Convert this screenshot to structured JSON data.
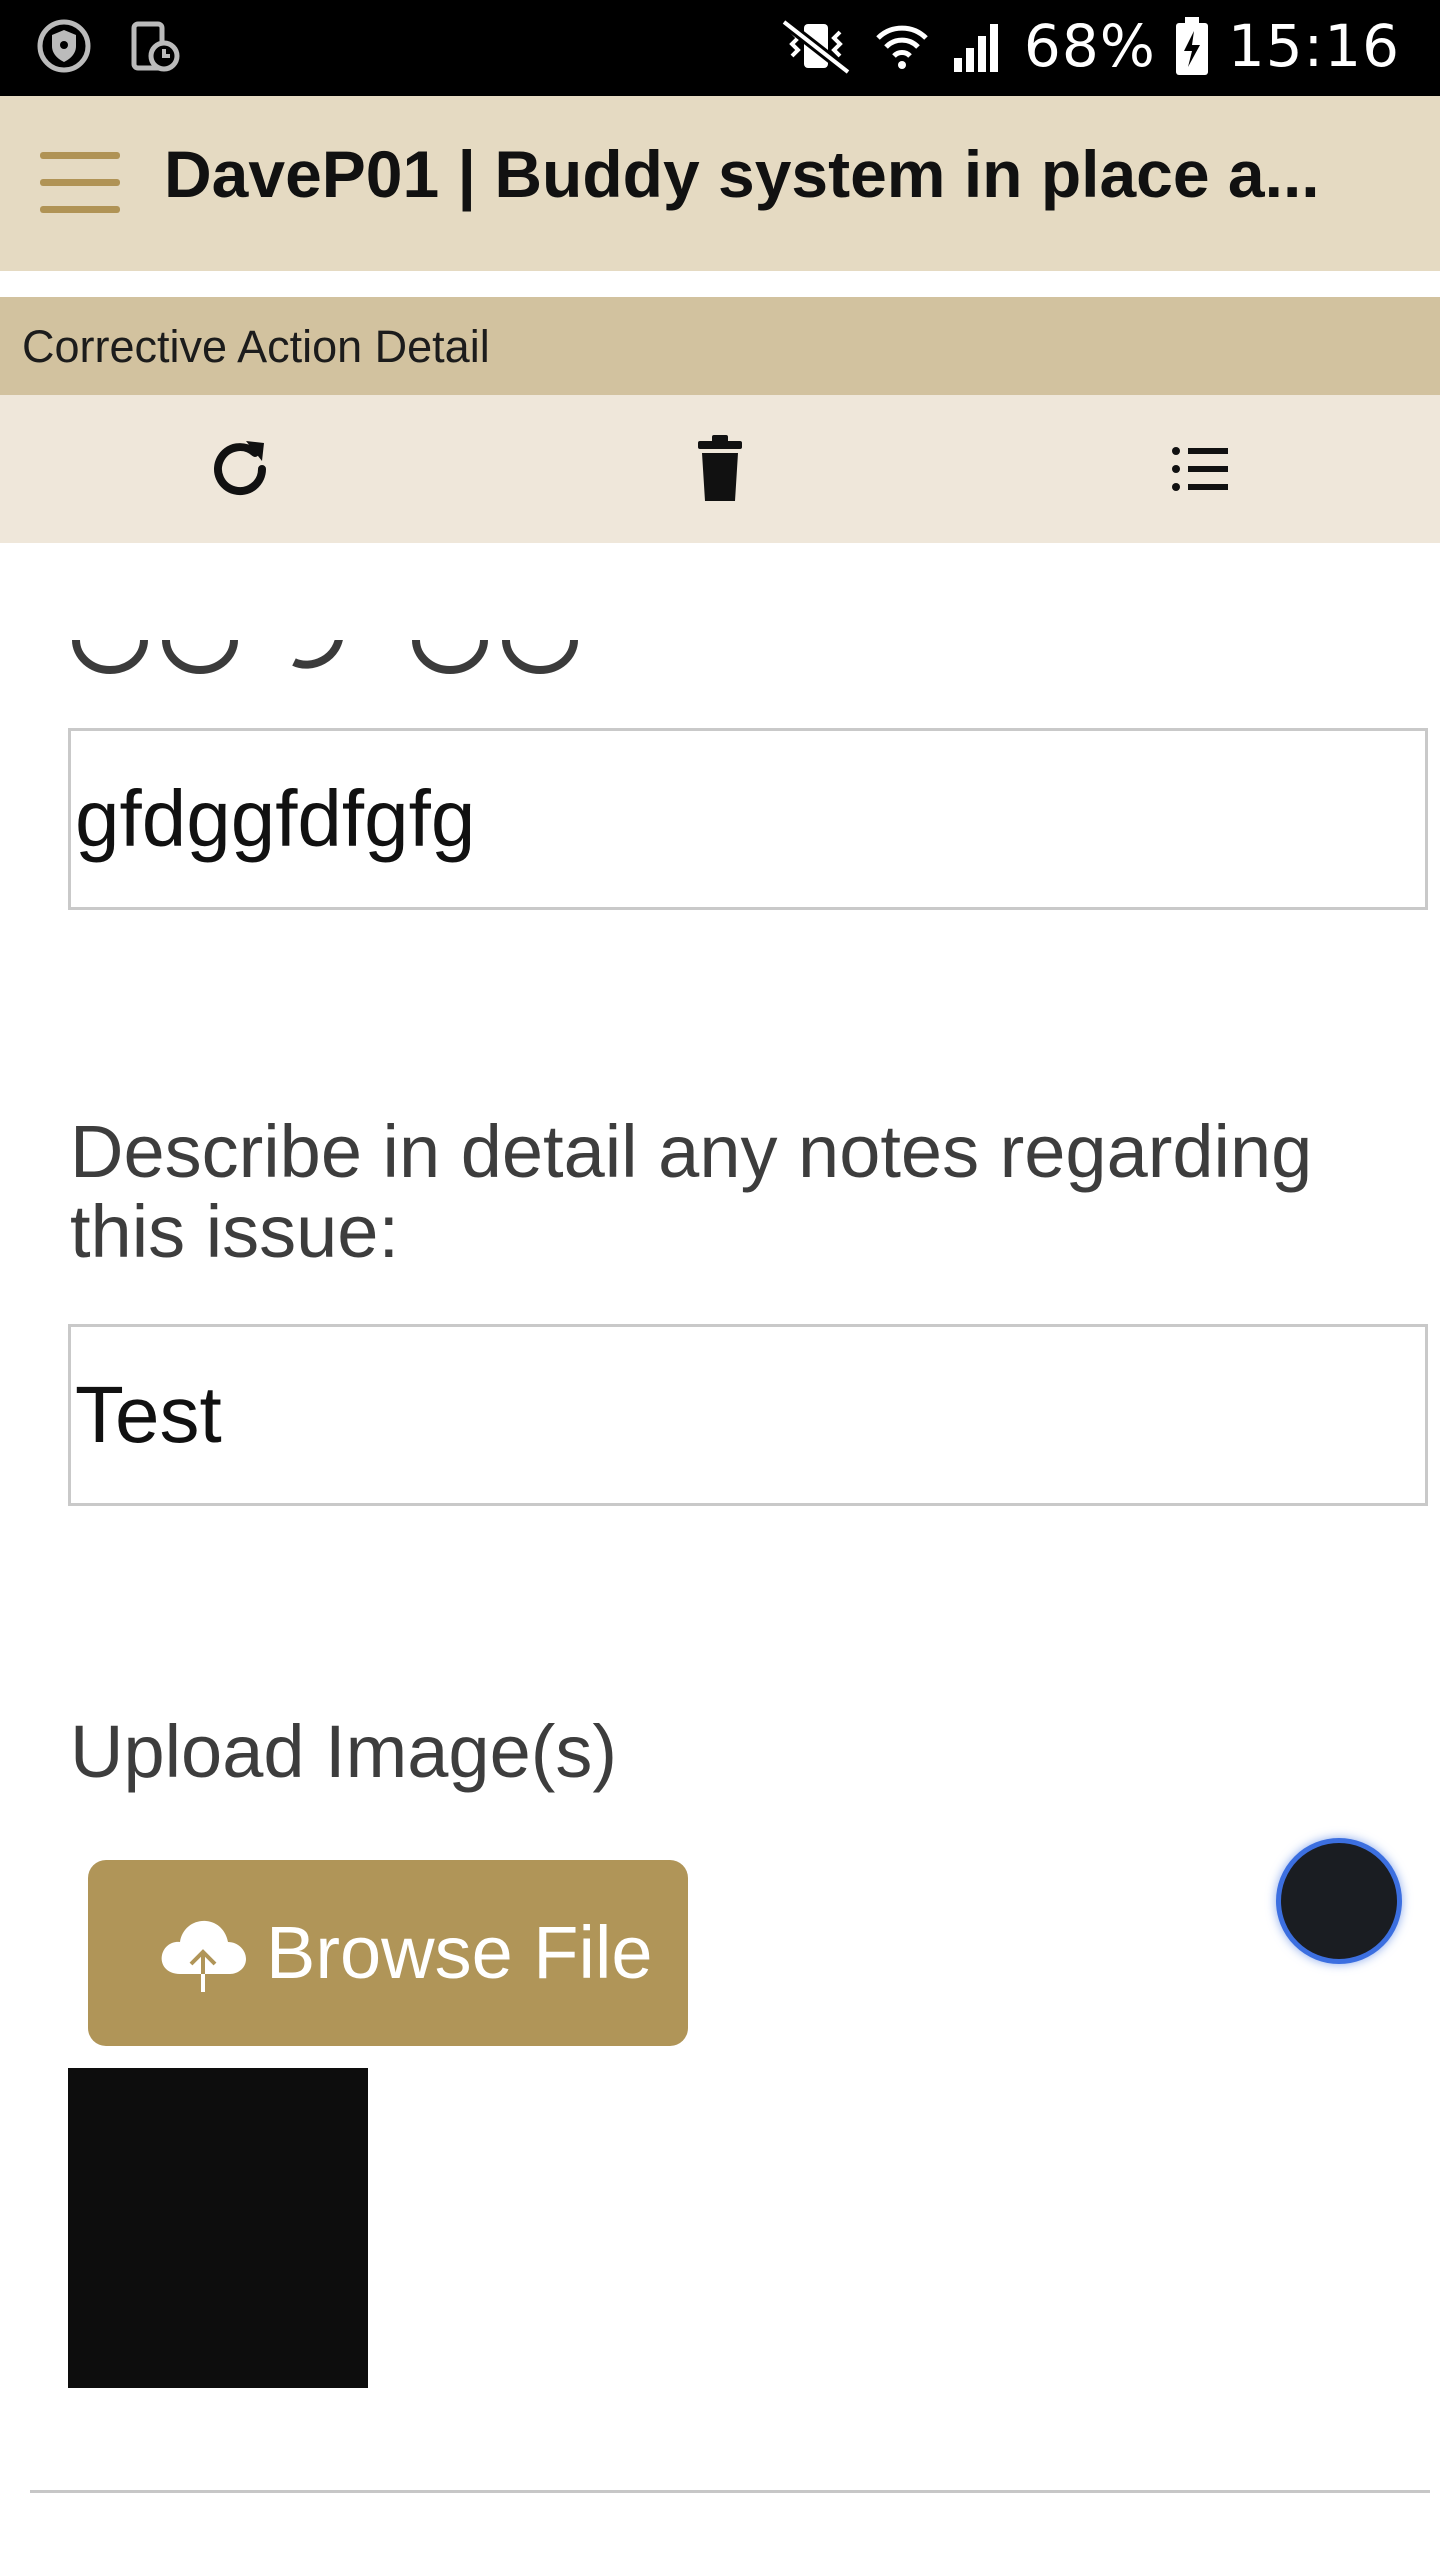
{
  "status_bar": {
    "battery": "68%",
    "time": "15:16",
    "icons": [
      "shield-icon",
      "device-clock-icon",
      "vibrate-mute-icon",
      "wifi-icon",
      "signal-icon",
      "battery-charging-icon"
    ]
  },
  "app_bar": {
    "title": "DaveP01 | Buddy system in place a...",
    "menu_icon": "hamburger-menu-icon"
  },
  "section": {
    "title": "Corrective Action Detail"
  },
  "toolbar": {
    "icons": [
      "refresh-icon",
      "delete-icon",
      "list-icon"
    ]
  },
  "form": {
    "field1_value": "gfdggfdfgfg",
    "notes_label": "Describe in detail any notes regarding this issue:",
    "notes_value": "Test",
    "upload_label": "Upload Image(s)",
    "browse_label": "Browse File"
  },
  "colors": {
    "status_bar": "#000000",
    "app_bar": "#e5dac2",
    "section_header": "#d2c29f",
    "toolbar": "#efe7da",
    "accent_gold": "#b09558",
    "fab_ring": "#3c6fe0"
  }
}
